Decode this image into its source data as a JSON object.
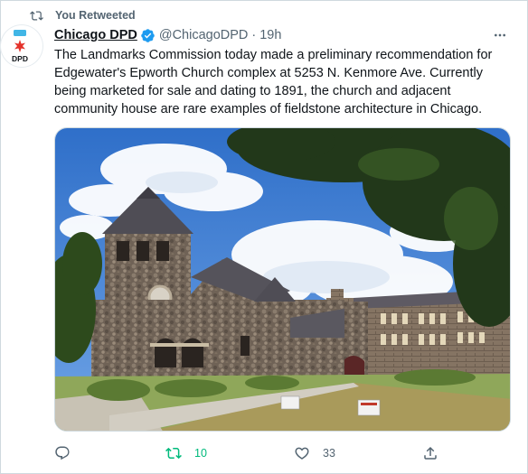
{
  "retweet_context": {
    "label": "You Retweeted"
  },
  "author": {
    "display_name": "Chicago DPD",
    "handle": "@ChicagoDPD",
    "separator": "·",
    "time_ago": "19h",
    "avatar_text": "DPD"
  },
  "tweet": {
    "text": "The Landmarks Commission today made a preliminary recommendation for Edgewater's Epworth Church complex at 5253 N. Kenmore Ave. Currently being marketed for sale and dating to 1891, the church and adjacent community house are rare examples of fieldstone architecture in Chicago."
  },
  "media": {
    "signs": [
      {
        "text": ""
      },
      {
        "text": ""
      }
    ]
  },
  "actions": {
    "reply_count": "",
    "retweet_count": "10",
    "like_count": "33"
  },
  "colors": {
    "accent": "#1d9bf0",
    "retweet_active": "#00ba7c",
    "muted_text": "#536471",
    "avatar_red": "#e4322b",
    "avatar_blue": "#41b6e6"
  },
  "icons": {
    "retweet": "retweet-icon",
    "verified": "verified-badge-icon",
    "more": "more-dots-icon",
    "reply": "reply-icon",
    "like": "heart-icon",
    "share": "share-icon"
  }
}
